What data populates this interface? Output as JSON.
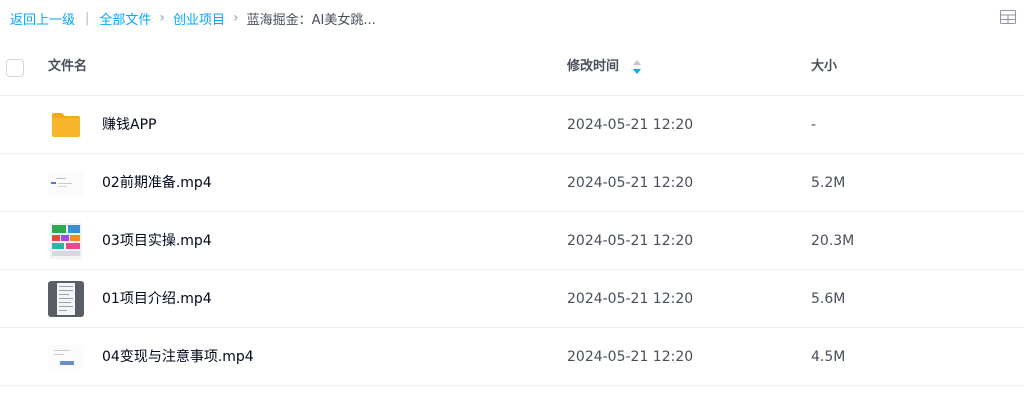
{
  "breadcrumb": {
    "back": "返回上一级",
    "all_files": "全部文件",
    "folder": "创业项目",
    "current": "蓝海掘金：AI美女跳..."
  },
  "icons": {
    "view_toggle": "grid-view-icon",
    "sort": "sort-arrows-icon",
    "folder": "folder-icon",
    "video_thumb": "video-thumbnail"
  },
  "colors": {
    "accent": "#06a7ff",
    "folder": "#f7b52c"
  },
  "table": {
    "headers": {
      "name": "文件名",
      "modified": "修改时间",
      "size": "大小"
    },
    "rows": [
      {
        "name": "赚钱APP",
        "modified": "2024-05-21 12:20",
        "size": "-"
      },
      {
        "name": "02前期准备.mp4",
        "modified": "2024-05-21 12:20",
        "size": "5.2M"
      },
      {
        "name": "03项目实操.mp4",
        "modified": "2024-05-21 12:20",
        "size": "20.3M"
      },
      {
        "name": "01项目介绍.mp4",
        "modified": "2024-05-21 12:20",
        "size": "5.6M"
      },
      {
        "name": "04变现与注意事项.mp4",
        "modified": "2024-05-21 12:20",
        "size": "4.5M"
      }
    ]
  }
}
